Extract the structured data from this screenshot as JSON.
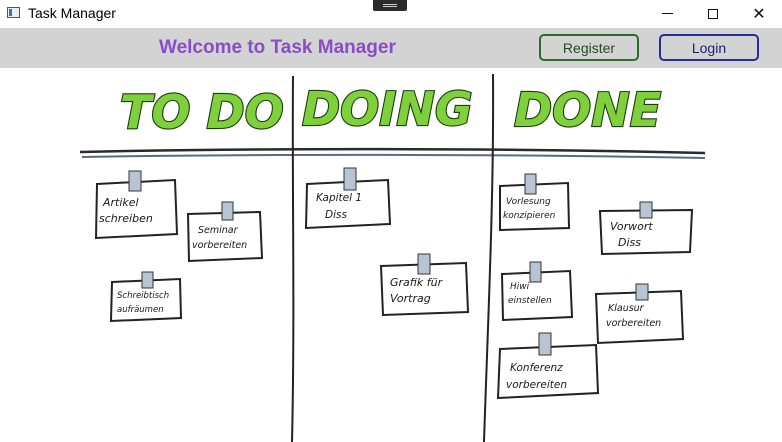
{
  "window": {
    "title": "Task Manager",
    "controls": {
      "minimize": "minimize",
      "maximize": "maximize",
      "close": "close"
    }
  },
  "header": {
    "welcome": "Welcome to Task Manager",
    "register_label": "Register",
    "login_label": "Login"
  },
  "board": {
    "columns": [
      {
        "title": "TO DO"
      },
      {
        "title": "DOING"
      },
      {
        "title": "DONE"
      }
    ],
    "notes_todo": [
      {
        "line1": "Artikel",
        "line2": "schreiben"
      },
      {
        "line1": "Seminar",
        "line2": "vorbereiten"
      },
      {
        "line1": "Schreibtisch",
        "line2": "aufräumen"
      }
    ],
    "notes_doing": [
      {
        "line1": "Kapitel 1",
        "line2": "Diss"
      },
      {
        "line1": "Grafik für",
        "line2": "Vortrag"
      }
    ],
    "notes_done": [
      {
        "line1": "Vorlesung",
        "line2": "konzipieren"
      },
      {
        "line1": "Vorwort",
        "line2": "Diss"
      },
      {
        "line1": "Hiwi",
        "line2": "einstellen"
      },
      {
        "line1": "Klausur",
        "line2": "vorbereiten"
      },
      {
        "line1": "Konferenz",
        "line2": "vorbereiten"
      }
    ]
  },
  "colors": {
    "header_bg": "#d3d3d3",
    "welcome_text": "#8a4cc9",
    "register_border": "#2d6b2d",
    "login_border": "#2a2a9a",
    "column_title_fill": "#7ed13a"
  }
}
